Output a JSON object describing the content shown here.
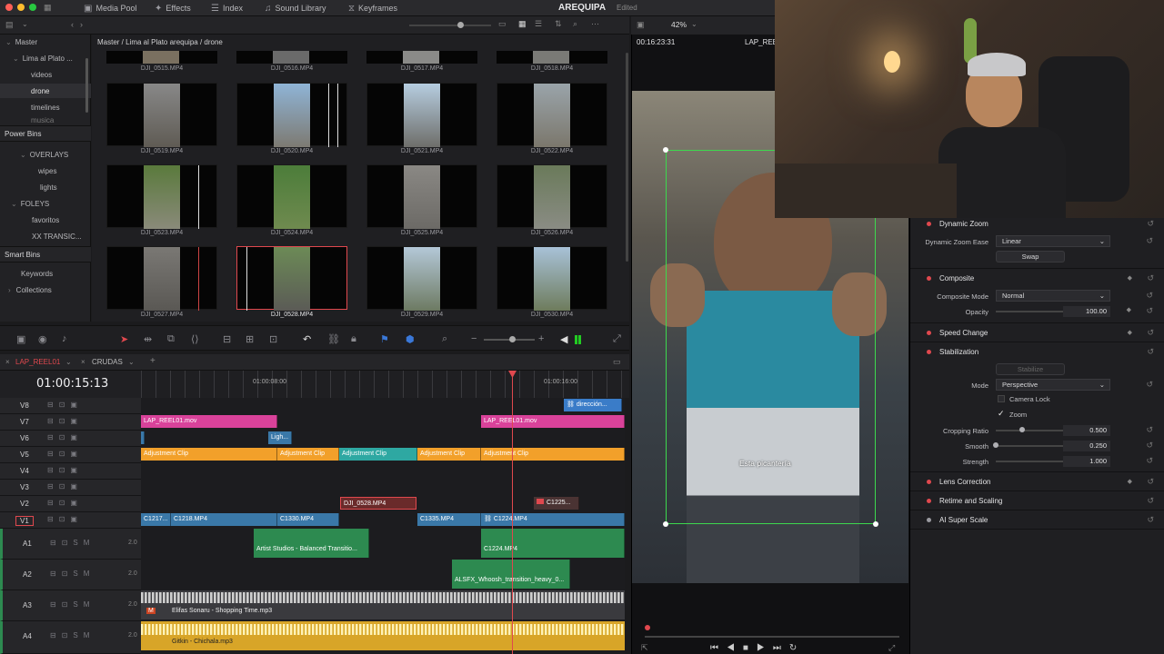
{
  "topbar": {
    "tabs": [
      "Media Pool",
      "Effects",
      "Index",
      "Sound Library",
      "Keyframes"
    ],
    "project_title": "AREQUIPA",
    "status": "Edited",
    "zoom": "42%"
  },
  "bins": {
    "master": "Master",
    "items": [
      "Lima al Plato ...",
      "videos",
      "drone",
      "timelines",
      "musica"
    ],
    "power_bins_label": "Power Bins",
    "power_items": [
      "OVERLAYS",
      "wipes",
      "lights",
      "FOLEYS",
      "favoritos",
      "XX TRANSIC..."
    ],
    "smart_bins_label": "Smart Bins",
    "smart_items": [
      "Keywords",
      "Collections"
    ]
  },
  "media": {
    "breadcrumb": "Master / Lima al Plato arequipa / drone",
    "top_labels": [
      "DJI_0515.MP4",
      "DJI_0516.MP4",
      "DJI_0517.MP4",
      "DJI_0518.MP4"
    ],
    "clips": [
      "DJI_0519.MP4",
      "DJI_0520.MP4",
      "DJI_0521.MP4",
      "DJI_0522.MP4",
      "DJI_0523.MP4",
      "DJI_0524.MP4",
      "DJI_0525.MP4",
      "DJI_0526.MP4",
      "DJI_0527.MP4",
      "DJI_0528.MP4",
      "DJI_0529.MP4",
      "DJI_0530.MP4"
    ]
  },
  "timeline": {
    "tabs": [
      "LAP_REEL01",
      "CRUDAS"
    ],
    "timecode": "01:00:15:13",
    "ruler": [
      "01:00:08:00",
      "01:00:16:00"
    ],
    "video_tracks": [
      "V8",
      "V7",
      "V6",
      "V5",
      "V4",
      "V3",
      "V2",
      "V1"
    ],
    "audio_tracks": [
      "A1",
      "A2",
      "A3",
      "A4"
    ],
    "audio_level": "2.0",
    "clips": {
      "v8_a": "dirección...",
      "v7_a": "LAP_REEL01.mov",
      "v7_b": "LAP_REEL01.mov",
      "v6_a": "Ligh...",
      "v5_a": "Adjustment Clip",
      "v5_b": "Adjustment Clip",
      "v5_c": "Adjustment Clip",
      "v5_d": "Adjustment Clip",
      "v5_e": "Adjustment Clip",
      "v2_a": "DJI_0528.MP4",
      "v2_b": "C1225...",
      "v1_a": "C1217...",
      "v1_b": "C1218.MP4",
      "v1_c": "C1330.MP4",
      "v1_d": "C1335.MP4",
      "v1_e": "C1224.MP4",
      "a1_a": "Artist Studios - Balanced Transitio...",
      "a1_b": "C1224.MP4",
      "a2_a": "ALSFX_Whoosh_transition_heavy_0...",
      "a3_a": "Elifas Sonaru - Shopping Time.mp3",
      "a4_a": "Gitkin - Chichala.mp3"
    }
  },
  "viewer": {
    "timecode": "00:16:23:31",
    "clip_name": "LAP_REEL",
    "subtitle": "Esta picantería"
  },
  "inspector": {
    "dynamic_zoom": "Dynamic Zoom",
    "dz_ease_label": "Dynamic Zoom Ease",
    "dz_ease_value": "Linear",
    "swap": "Swap",
    "composite": "Composite",
    "composite_mode_label": "Composite Mode",
    "composite_mode_value": "Normal",
    "opacity_label": "Opacity",
    "opacity_value": "100.00",
    "speed_change": "Speed Change",
    "stabilization": "Stabilization",
    "stabilize_btn": "Stabilize",
    "mode_label": "Mode",
    "mode_value": "Perspective",
    "camera_lock": "Camera Lock",
    "zoom": "Zoom",
    "cropping_label": "Cropping Ratio",
    "cropping_value": "0.500",
    "smooth_label": "Smooth",
    "smooth_value": "0.250",
    "strength_label": "Strength",
    "strength_value": "1.000",
    "lens_correction": "Lens Correction",
    "retime_scaling": "Retime and Scaling",
    "ai_super_scale": "AI Super Scale"
  },
  "colors": {
    "accent_red": "#e0484e",
    "clip_pink": "#d9429a",
    "clip_orange": "#f2a02a",
    "clip_teal": "#2ea8a2",
    "clip_blue": "#3a78a8",
    "clip_green": "#2d8a50",
    "clip_yellow": "#d8a528"
  }
}
